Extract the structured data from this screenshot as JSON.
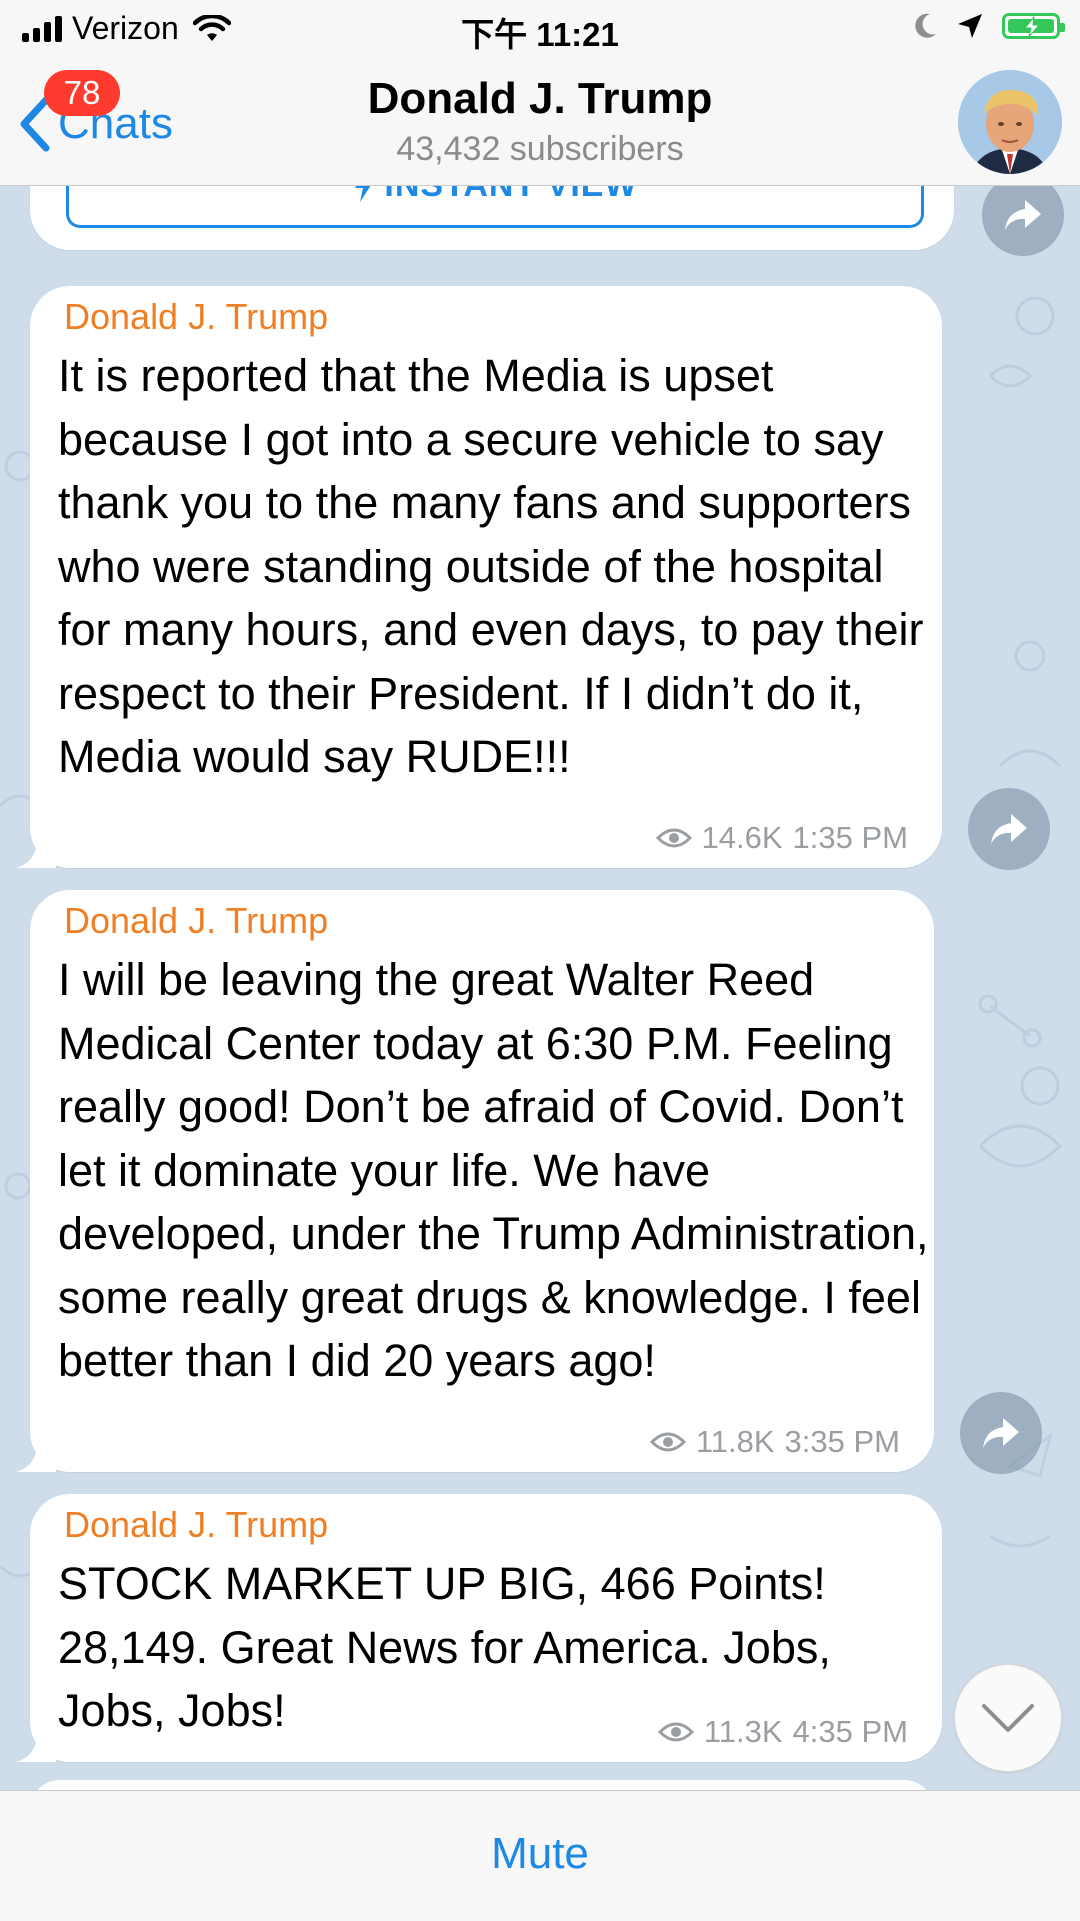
{
  "status_bar": {
    "carrier": "Verizon",
    "time": "下午 11:21",
    "icons": [
      "signal-icon",
      "wifi-icon",
      "moon-icon",
      "location-icon",
      "battery-charging-icon"
    ]
  },
  "nav": {
    "back_label": "Chats",
    "unread_badge": "78",
    "title": "Donald J. Trump",
    "subtitle": "43,432 subscribers"
  },
  "instant_view": {
    "label": "INSTANT VIEW",
    "icon": "lightning-icon"
  },
  "messages": [
    {
      "sender": "Donald J. Trump",
      "text": "It is reported that the Media is upset because I got into a secure vehicle to say thank you to the many fans and supporters who were standing outside of the hospital for many hours, and even days, to pay their respect to their President. If I didn’t do it, Media would say RUDE!!!",
      "views": "14.6K",
      "time": "1:35 PM"
    },
    {
      "sender": "Donald J. Trump",
      "text": "I will be leaving the great Walter Reed Medical Center today at 6:30 P.M. Feeling really good! Don’t be afraid of Covid. Don’t let it dominate your life. We have developed, under the Trump Administration, some really great drugs & knowledge. I feel better than I did 20 years ago!",
      "views": "11.8K",
      "time": "3:35 PM"
    },
    {
      "sender": "Donald J. Trump",
      "text": "STOCK MARKET UP BIG, 466 Points! 28,149. Great News for America. Jobs, Jobs, Jobs!",
      "views": "11.3K",
      "time": "4:35 PM"
    }
  ],
  "bottom_bar": {
    "mute_label": "Mute"
  },
  "colors": {
    "accent": "#1e88e5",
    "sender": "#f07f24",
    "badge": "#ff3b30",
    "chat_background": "#cfdcea",
    "battery": "#34c759"
  }
}
